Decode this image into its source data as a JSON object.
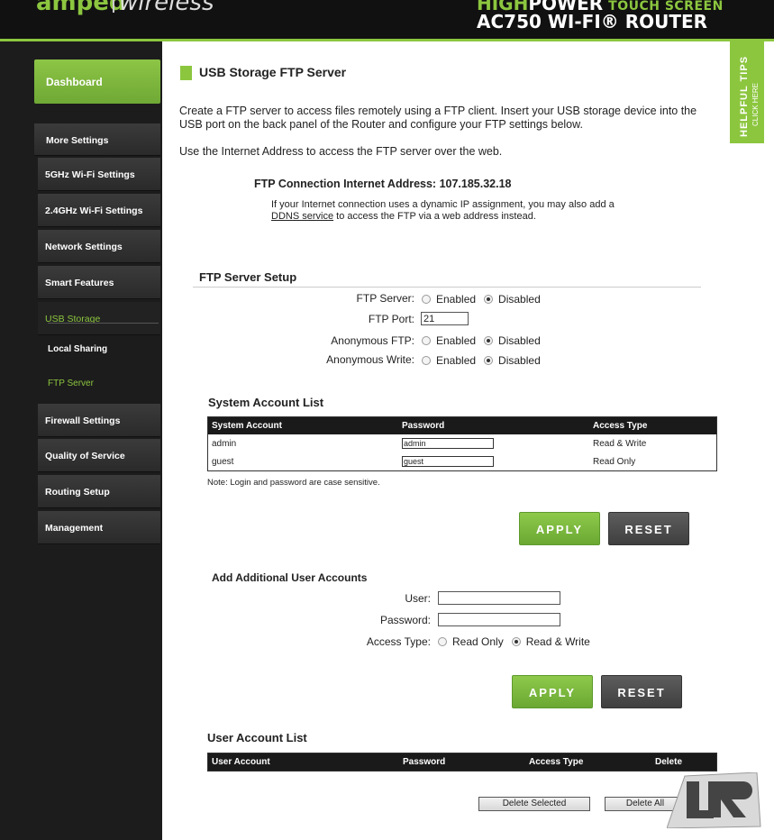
{
  "header": {
    "brand_amped": "amped",
    "brand_wireless": "wireless",
    "hp_high": "HIGH",
    "hp_power": "POWER",
    "hp_touch": "TOUCH SCREEN",
    "model": "AC750 WI-FI® ROUTER"
  },
  "helpful_tips": {
    "title": "HELPFUL TIPS",
    "sub": "CLICK HERE"
  },
  "sidebar": {
    "dashboard": "Dashboard",
    "more_settings": "More Settings",
    "items": [
      "5GHz Wi-Fi Settings",
      "2.4GHz Wi-Fi Settings",
      "Network Settings",
      "Smart Features",
      "USB Storage"
    ],
    "usb_sub": [
      "Local Sharing",
      "FTP Server"
    ],
    "items_after": [
      "Firewall Settings",
      "Quality of Service",
      "Routing Setup",
      "Management"
    ]
  },
  "page": {
    "title": "USB Storage FTP Server",
    "intro": "Create a FTP server to access files remotely using a FTP client. Insert your USB storage device into the USB port on the back panel of the Router and configure your FTP settings below.",
    "intro2": "Use the Internet Address to access the FTP server over the web.",
    "conn_label": "FTP Connection Internet Address:  107.185.32.18",
    "conn_note_pre": "If your Internet connection uses a dynamic IP assignment, you may also add a",
    "conn_note_link": "DDNS service",
    "conn_note_post": " to access the FTP via a web address instead."
  },
  "ftp_setup": {
    "title": "FTP Server Setup",
    "ftp_server_label": "FTP Server:",
    "ftp_port_label": "FTP Port:",
    "ftp_port_value": "21",
    "anon_ftp_label": "Anonymous FTP:",
    "anon_write_label": "Anonymous Write:",
    "enabled": "Enabled",
    "disabled": "Disabled"
  },
  "system_accounts": {
    "title": "System Account List",
    "headers": [
      "System Account",
      "Password",
      "Access Type"
    ],
    "rows": [
      {
        "account": "admin",
        "password": "admin",
        "access": "Read & Write"
      },
      {
        "account": "guest",
        "password": "guest",
        "access": "Read Only"
      }
    ],
    "note": "Note: Login and password are case sensitive."
  },
  "buttons": {
    "apply": "APPLY",
    "reset": "RESET"
  },
  "add_user": {
    "title": "Add Additional User Accounts",
    "user_label": "User:",
    "password_label": "Password:",
    "access_label": "Access Type:",
    "read_only": "Read Only",
    "read_write": "Read & Write",
    "user_value": "",
    "password_value": ""
  },
  "user_accounts": {
    "title": "User Account List",
    "headers": [
      "User Account",
      "Password",
      "Access Type",
      "Delete"
    ],
    "delete_selected": "Delete Selected",
    "delete_all": "Delete All"
  },
  "colors": {
    "accent": "#8cc63f",
    "dark": "#1a1a1a",
    "gray_btn": "#4e4e4e"
  }
}
